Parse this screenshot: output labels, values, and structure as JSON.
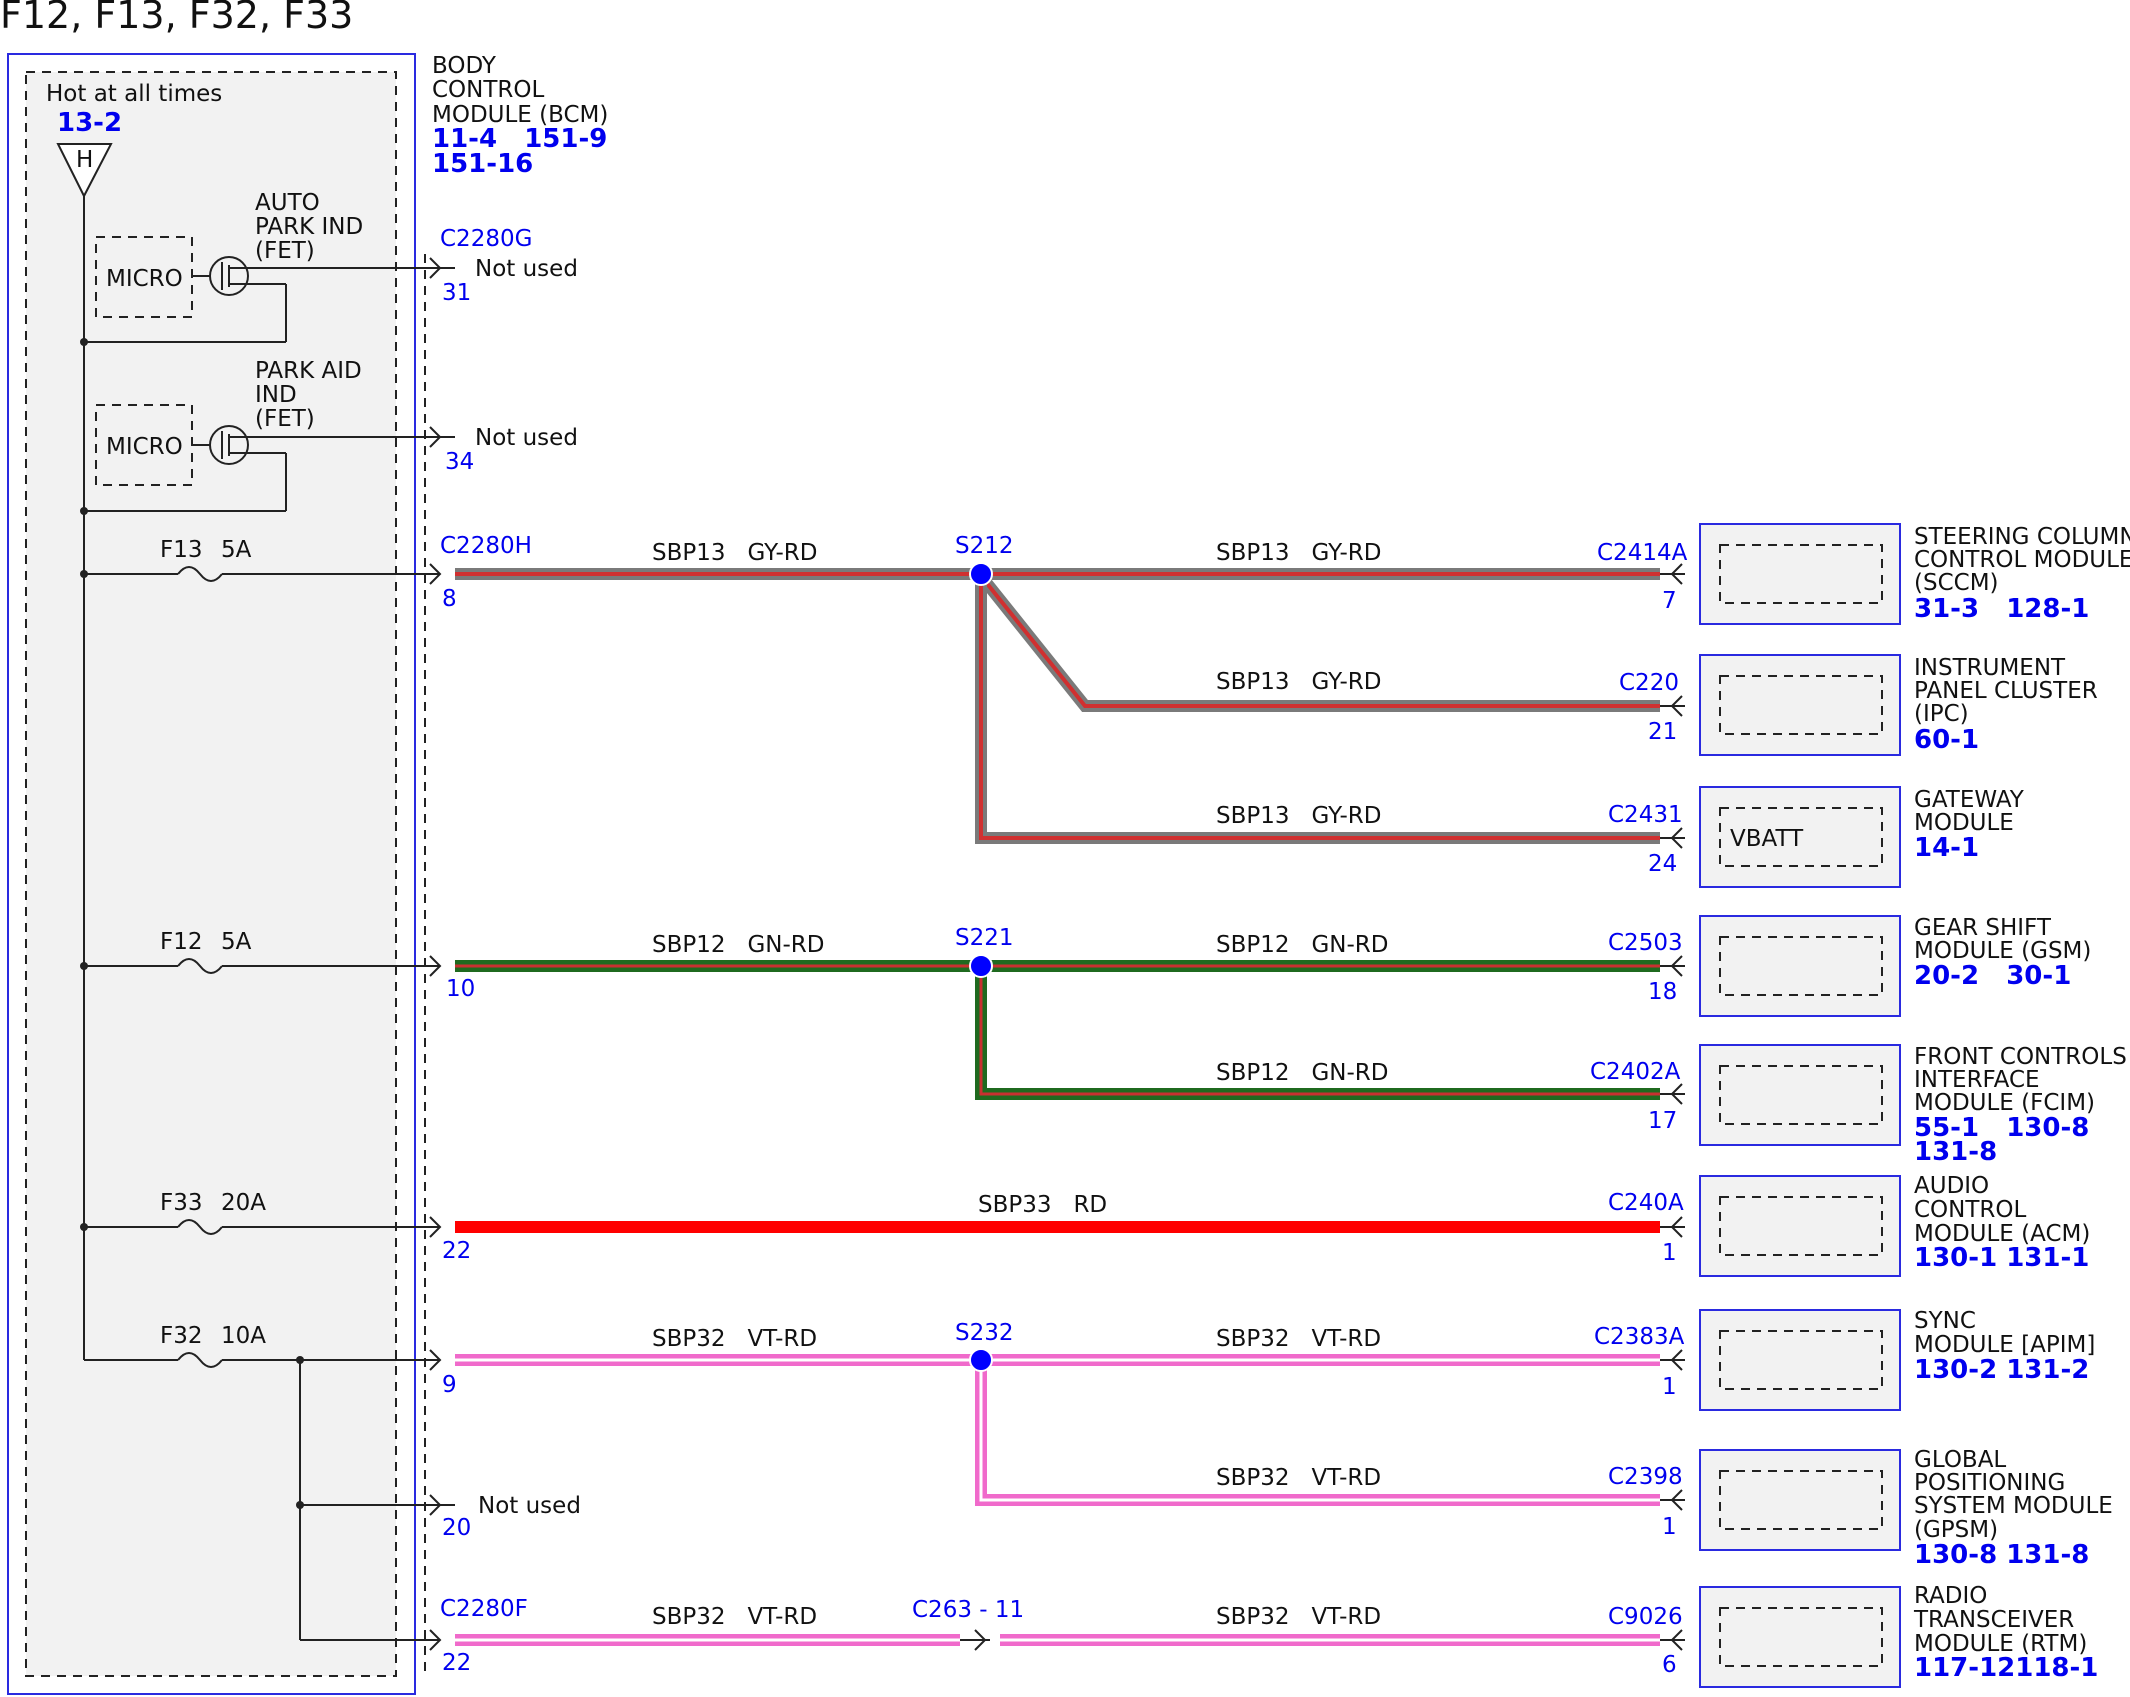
{
  "title": "F12, F13, F32, F33",
  "bcm": {
    "name_lines": [
      "BODY",
      "CONTROL",
      "MODULE (BCM)"
    ],
    "refs_line1": "11-4   151-9",
    "refs_line2": "151-16",
    "hot_label": "Hot at all times",
    "hot_ref": "13-2",
    "h_symbol": "H",
    "auto_park": {
      "lines": [
        "AUTO",
        "PARK IND",
        "(FET)"
      ],
      "micro": "MICRO"
    },
    "park_aid": {
      "lines": [
        "PARK AID",
        "IND",
        "(FET)"
      ],
      "micro": "MICRO"
    }
  },
  "fuses": [
    {
      "name": "F13",
      "rating": "5A"
    },
    {
      "name": "F12",
      "rating": "5A"
    },
    {
      "name": "F33",
      "rating": "20A"
    },
    {
      "name": "F32",
      "rating": "10A"
    }
  ],
  "bcm_pins": {
    "c2280g": {
      "connector": "C2280G",
      "pin": "31",
      "note": "Not used"
    },
    "p34": {
      "pin": "34",
      "note": "Not used"
    },
    "c2280h": {
      "connector": "C2280H",
      "pin": "8"
    },
    "p10": {
      "pin": "10"
    },
    "p22": {
      "pin": "22"
    },
    "p9": {
      "pin": "9"
    },
    "p20": {
      "pin": "20",
      "note": "Not used"
    },
    "c2280f": {
      "connector": "C2280F",
      "pin": "22"
    }
  },
  "splices": {
    "s212": "S212",
    "s221": "S221",
    "s232": "S232"
  },
  "inline": {
    "label": "C263 - 11"
  },
  "wires": {
    "sbp13_a": "SBP13   GY-RD",
    "sbp13_b": "SBP13   GY-RD",
    "sbp13_c": "SBP13   GY-RD",
    "sbp13_d": "SBP13   GY-RD",
    "sbp12_a": "SBP12   GN-RD",
    "sbp12_b": "SBP12   GN-RD",
    "sbp12_c": "SBP12   GN-RD",
    "sbp33": "SBP33   RD",
    "sbp32_a": "SBP32   VT-RD",
    "sbp32_b": "SBP32   VT-RD",
    "sbp32_c": "SBP32   VT-RD",
    "sbp32_d": "SBP32   VT-RD",
    "sbp32_e": "SBP32   VT-RD"
  },
  "modules": [
    {
      "connector": "C2414A",
      "pin": "7",
      "inner": "",
      "lines": [
        "STEERING COLUMN",
        "CONTROL MODULE",
        "(SCCM)"
      ],
      "refs": [
        "31-3   128-1"
      ]
    },
    {
      "connector": "C220",
      "pin": "21",
      "inner": "",
      "lines": [
        "INSTRUMENT",
        "PANEL CLUSTER",
        "(IPC)"
      ],
      "refs": [
        "60-1"
      ]
    },
    {
      "connector": "C2431",
      "pin": "24",
      "inner": "VBATT",
      "lines": [
        "GATEWAY",
        "MODULE"
      ],
      "refs": [
        "14-1"
      ]
    },
    {
      "connector": "C2503",
      "pin": "18",
      "inner": "",
      "lines": [
        "GEAR SHIFT",
        "MODULE (GSM)"
      ],
      "refs": [
        "20-2   30-1"
      ]
    },
    {
      "connector": "C2402A",
      "pin": "17",
      "inner": "",
      "lines": [
        "FRONT CONTROLS",
        "INTERFACE",
        "MODULE (FCIM)"
      ],
      "refs": [
        "55-1   130-8",
        "131-8"
      ]
    },
    {
      "connector": "C240A",
      "pin": "1",
      "inner": "",
      "lines": [
        "AUDIO",
        "CONTROL",
        "MODULE (ACM)"
      ],
      "refs": [
        "130-1 131-1"
      ]
    },
    {
      "connector": "C2383A",
      "pin": "1",
      "inner": "",
      "lines": [
        "SYNC",
        "MODULE [APIM]"
      ],
      "refs": [
        "130-2 131-2"
      ]
    },
    {
      "connector": "C2398",
      "pin": "1",
      "inner": "",
      "lines": [
        "GLOBAL",
        "POSITIONING",
        "SYSTEM MODULE",
        "(GPSM)"
      ],
      "refs": [
        "130-8 131-8"
      ]
    },
    {
      "connector": "C9026",
      "pin": "6",
      "inner": "",
      "lines": [
        "RADIO",
        "TRANSCEIVER",
        "MODULE (RTM)"
      ],
      "refs": [
        "117-12118-1"
      ]
    }
  ],
  "colors": {
    "bcm_border": "#2a2ae0",
    "box_fill": "#f2f2f2",
    "splice": "#0000ff",
    "gy_rd": {
      "outer": "#7a7a7a",
      "inner": "#d03030"
    },
    "gn_rd": {
      "outer": "#1f6a1f",
      "inner": "#c83030"
    },
    "rd": {
      "outer": "#ff0000",
      "inner": "#ff0000"
    },
    "vt_rd": {
      "outer": "#f06acb",
      "inner": "#ffffff"
    }
  }
}
